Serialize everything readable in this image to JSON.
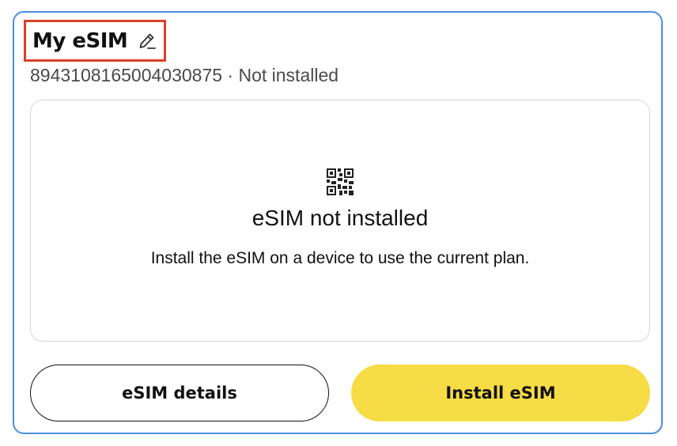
{
  "card": {
    "title": "My eSIM",
    "subtitle": "8943108165004030875 · Not installed",
    "edit_icon": "pencil-icon",
    "status": {
      "icon": "qr-code-icon",
      "title": "eSIM not installed",
      "description": "Install the eSIM on a device to use the current plan."
    },
    "buttons": {
      "details_label": "eSIM details",
      "install_label": "Install eSIM"
    }
  },
  "colors": {
    "card_border": "#4a90e2",
    "highlight_border": "#d9412b",
    "install_button": "#f6dc45"
  }
}
